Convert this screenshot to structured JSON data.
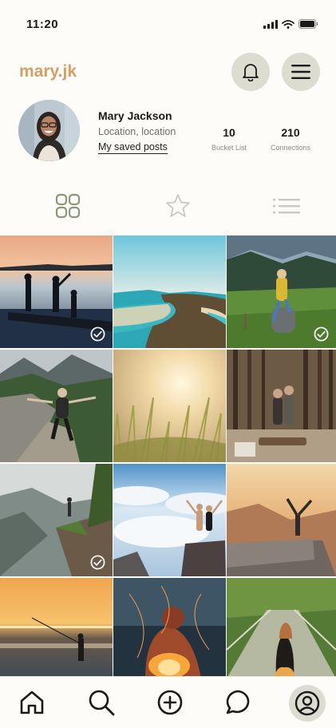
{
  "status_bar": {
    "time": "11:20"
  },
  "header": {
    "username": "mary.jk",
    "notifications_icon": "bell-icon",
    "menu_icon": "hamburger-menu-icon"
  },
  "profile": {
    "name": "Mary Jackson",
    "location": "Location, location",
    "saved_posts_link": "My saved posts",
    "stats": [
      {
        "value": "10",
        "label": "Bucket List"
      },
      {
        "value": "210",
        "label": "Connections"
      }
    ]
  },
  "tabs": [
    {
      "icon": "grid-icon",
      "active": true
    },
    {
      "icon": "star-icon",
      "active": false
    },
    {
      "icon": "list-icon",
      "active": false
    }
  ],
  "photos": [
    {
      "subject": "three people on pier at sunset",
      "completed": true
    },
    {
      "subject": "coastline peninsula",
      "completed": false
    },
    {
      "subject": "woman sitting on rock in meadow",
      "completed": true
    },
    {
      "subject": "hiker on mountain trail",
      "completed": false
    },
    {
      "subject": "sun over grass",
      "completed": false
    },
    {
      "subject": "couple camping in forest",
      "completed": false
    },
    {
      "subject": "person on cliff edge",
      "completed": true
    },
    {
      "subject": "couple on peak above clouds",
      "completed": false
    },
    {
      "subject": "person handstand on rock",
      "completed": false
    },
    {
      "subject": "fishing at sunset beach",
      "completed": false
    },
    {
      "subject": "person by campfire",
      "completed": false
    },
    {
      "subject": "woman on suspension bridge",
      "completed": false
    }
  ],
  "bottom_nav": [
    {
      "icon": "home-icon"
    },
    {
      "icon": "search-icon"
    },
    {
      "icon": "add-icon"
    },
    {
      "icon": "chat-icon"
    },
    {
      "icon": "profile-icon",
      "active": true
    }
  ],
  "colors": {
    "accent": "#d4a064",
    "button_bg": "#dcdcd0",
    "active_tab": "#8c9878",
    "background": "#fdfcf8"
  }
}
